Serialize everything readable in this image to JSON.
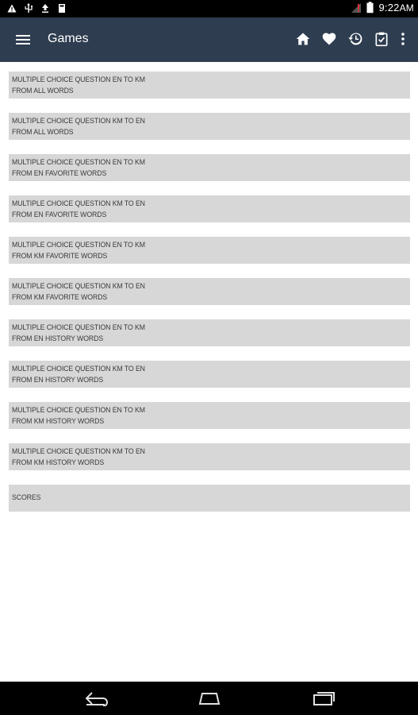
{
  "status_bar": {
    "time": "9:22",
    "time_suffix": "AM",
    "icons": [
      "warning-icon",
      "usb-icon",
      "upload-icon",
      "storage-icon",
      "signal-icon",
      "battery-icon"
    ]
  },
  "app_bar": {
    "title": "Games",
    "actions": [
      "home-icon",
      "favorite-icon",
      "history-icon",
      "clipboard-icon",
      "more-icon"
    ]
  },
  "games": [
    {
      "line1": "MULTIPLE CHOICE QUESTION EN TO KM",
      "line2": "FROM ALL WORDS"
    },
    {
      "line1": "MULTIPLE CHOICE QUESTION KM TO EN",
      "line2": "FROM ALL WORDS"
    },
    {
      "line1": "MULTIPLE CHOICE QUESTION EN TO KM",
      "line2": "FROM EN FAVORITE WORDS"
    },
    {
      "line1": "MULTIPLE CHOICE QUESTION KM TO EN",
      "line2": "FROM EN FAVORITE WORDS"
    },
    {
      "line1": "MULTIPLE CHOICE QUESTION EN TO KM",
      "line2": "FROM KM FAVORITE WORDS"
    },
    {
      "line1": "MULTIPLE CHOICE QUESTION KM TO EN",
      "line2": "FROM KM FAVORITE WORDS"
    },
    {
      "line1": "MULTIPLE CHOICE QUESTION EN TO KM",
      "line2": "FROM EN HISTORY WORDS"
    },
    {
      "line1": "MULTIPLE CHOICE QUESTION KM TO EN",
      "line2": "FROM EN HISTORY WORDS"
    },
    {
      "line1": "MULTIPLE CHOICE QUESTION EN TO KM",
      "line2": "FROM KM HISTORY WORDS"
    },
    {
      "line1": "MULTIPLE CHOICE QUESTION KM TO EN",
      "line2": "FROM KM HISTORY WORDS"
    }
  ],
  "scores_label": "SCORES",
  "nav_bar": {
    "buttons": [
      "back-icon",
      "home-nav-icon",
      "recents-icon"
    ]
  },
  "colors": {
    "app_bar": "#2e3d50",
    "list_item": "#d6d7d6",
    "status_bar": "#000000"
  }
}
